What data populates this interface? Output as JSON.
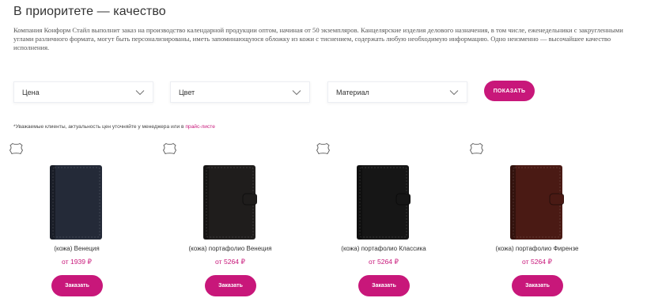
{
  "page": {
    "title": "В приоритете — качество",
    "intro": "Компания Конформ Стайл выполнит заказ на производство календарной продукции оптом, начиная от 50 экземпляров. Канцелярские изделия делового назначения, в том числе, еженедельники с закругленными углами различного формата, могут быть персонализированы, иметь запоминающуюся обложку из кожи с тиснением, содержать любую необходимую информацию. Одно неизменно — высочайшее качество исполнения."
  },
  "filters": {
    "price_label": "Цена",
    "color_label": "Цвет",
    "material_label": "Материал",
    "show_button": "ПОКАЗАТЬ"
  },
  "note": {
    "text": "*Уважаемые клиенты, актуальность цен уточняйте у менеджера или в ",
    "link": "прайс-листе"
  },
  "products": [
    {
      "name": "(кожа) Венеция",
      "price": "от 1939 ₽",
      "button": "Заказать",
      "cover_color": "#242a38",
      "icon": "leather-hide-icon"
    },
    {
      "name": "(кожа) портафолио Венеция",
      "price": "от 5264 ₽",
      "button": "Заказать",
      "cover_color": "#1f1d1c",
      "icon": "leather-hide-icon"
    },
    {
      "name": "(кожа) портафолио Классика",
      "price": "от 5264 ₽",
      "button": "Заказать",
      "cover_color": "#161616",
      "icon": "leather-hide-icon"
    },
    {
      "name": "(кожа) портафолио Фирензе",
      "price": "от 5264 ₽",
      "button": "Заказать",
      "cover_color": "#4a1a14",
      "icon": "leather-hide-icon"
    }
  ],
  "colors": {
    "accent": "#c8177a",
    "text": "#333333"
  }
}
